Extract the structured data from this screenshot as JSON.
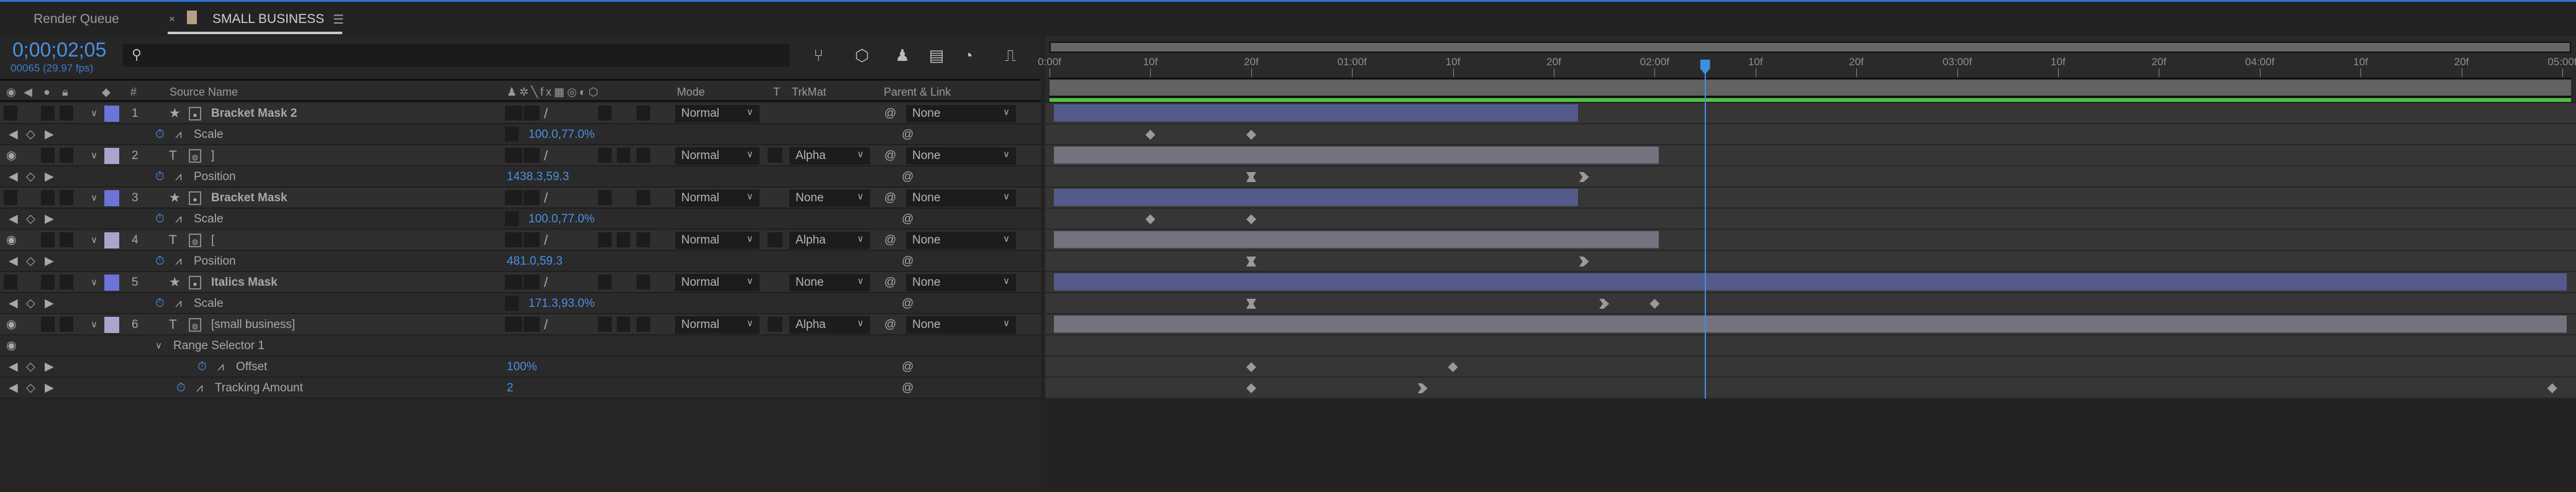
{
  "tabs": [
    {
      "label": "Render Queue"
    },
    {
      "label": "SMALL BUSINESS",
      "active": true,
      "swatch": "#b3a184"
    }
  ],
  "timecode": "0;00;02;05",
  "frame_info": "00065 (29.97 fps)",
  "search": {
    "value": "",
    "placeholder": ""
  },
  "columns": {
    "hash": "#",
    "source_name": "Source Name",
    "mode": "Mode",
    "t": "T",
    "trkmat": "TrkMat",
    "parent": "Parent & Link"
  },
  "current_frame": 65,
  "duration_frames": 150,
  "ruler_labels": [
    "0:00f",
    "10f",
    "20f",
    "01:00f",
    "10f",
    "20f",
    "02:00f",
    "10f",
    "20f",
    "03:00f",
    "10f",
    "20f",
    "04:00f",
    "10f",
    "20f",
    "05:00f"
  ],
  "layers": [
    {
      "num": "1",
      "name": "Bracket Mask 2",
      "type": "shape",
      "eye": false,
      "label": "#6b74d8",
      "mode": "Normal",
      "trkmat": null,
      "parent": "None",
      "bar": {
        "start": 0,
        "end": 52,
        "color": "#545b8c"
      },
      "props": [
        {
          "name": "Scale",
          "value": "100.0,77.0%",
          "kfs": [
            [
              10,
              "linear"
            ],
            [
              20,
              "linear"
            ]
          ]
        }
      ]
    },
    {
      "num": "2",
      "name": "]",
      "type": "text",
      "eye": true,
      "label": "#a9a6cc",
      "mode": "Normal",
      "trkmat": "Alpha",
      "parent": "None",
      "bar": {
        "start": 0,
        "end": 60,
        "color": "#74727f"
      },
      "props": [
        {
          "name": "Position",
          "value": "1438.3,59.3",
          "kfs": [
            [
              20,
              "easy-ease"
            ],
            [
              53,
              "ease-in"
            ]
          ]
        }
      ]
    },
    {
      "num": "3",
      "name": "Bracket Mask",
      "type": "shape",
      "eye": false,
      "label": "#6b74d8",
      "mode": "Normal",
      "trkmat": "None",
      "parent": "None",
      "bar": {
        "start": 0,
        "end": 52,
        "color": "#545b8c"
      },
      "props": [
        {
          "name": "Scale",
          "value": "100.0,77.0%",
          "kfs": [
            [
              10,
              "linear"
            ],
            [
              20,
              "linear"
            ]
          ]
        }
      ]
    },
    {
      "num": "4",
      "name": "[",
      "type": "text",
      "eye": true,
      "label": "#a9a6cc",
      "mode": "Normal",
      "trkmat": "Alpha",
      "parent": "None",
      "bar": {
        "start": 0,
        "end": 60,
        "color": "#74727f"
      },
      "props": [
        {
          "name": "Position",
          "value": "481.0,59.3",
          "kfs": [
            [
              20,
              "easy-ease"
            ],
            [
              53,
              "ease-in"
            ]
          ]
        }
      ]
    },
    {
      "num": "5",
      "name": "Italics Mask",
      "type": "shape",
      "eye": false,
      "label": "#6b74d8",
      "mode": "Normal",
      "trkmat": "None",
      "parent": "None",
      "bar": {
        "start": 0,
        "end": 150,
        "color": "#545b8c"
      },
      "props": [
        {
          "name": "Scale",
          "value": "171.3,93.0%",
          "kfs": [
            [
              20,
              "easy-ease"
            ],
            [
              55,
              "ease-in"
            ],
            [
              60,
              "linear"
            ]
          ]
        }
      ]
    },
    {
      "num": "6",
      "name": "[small business]",
      "type": "text",
      "eye": true,
      "label": "#a9a6cc",
      "mode": "Normal",
      "trkmat": "Alpha",
      "parent": "None",
      "bar": {
        "start": 0,
        "end": 150,
        "color": "#74727f"
      },
      "group": "Range Selector 1",
      "props": [
        {
          "name": "Offset",
          "value": "100%",
          "indent": true,
          "kfs": [
            [
              20,
              "linear"
            ],
            [
              40,
              "linear"
            ]
          ]
        },
        {
          "name": "Tracking Amount",
          "value": "2",
          "kfs": [
            [
              20,
              "linear"
            ],
            [
              37,
              "ease-in"
            ],
            [
              149,
              "linear"
            ]
          ]
        }
      ]
    }
  ]
}
